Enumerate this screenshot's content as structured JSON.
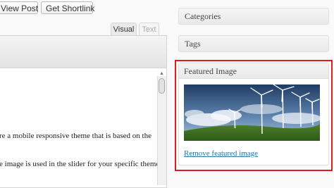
{
  "toolbar": {
    "view_post_label": "View Post",
    "get_shortlink_label": "Get Shortlink"
  },
  "editor": {
    "tabs": [
      {
        "label": "Visual",
        "active": true
      },
      {
        "label": "Text",
        "active": false
      }
    ],
    "content_lines": [
      "re a mobile responsive theme that is based on the",
      "e image is used in the slider for your specific theme."
    ]
  },
  "sidebar": {
    "categories_title": "Categories",
    "tags_title": "Tags",
    "featured_image": {
      "title": "Featured Image",
      "image_icon": "wind-turbines-photo",
      "remove_label": "Remove featured image"
    }
  },
  "colors": {
    "highlight": "#d81e1e",
    "link": "#21759b"
  }
}
